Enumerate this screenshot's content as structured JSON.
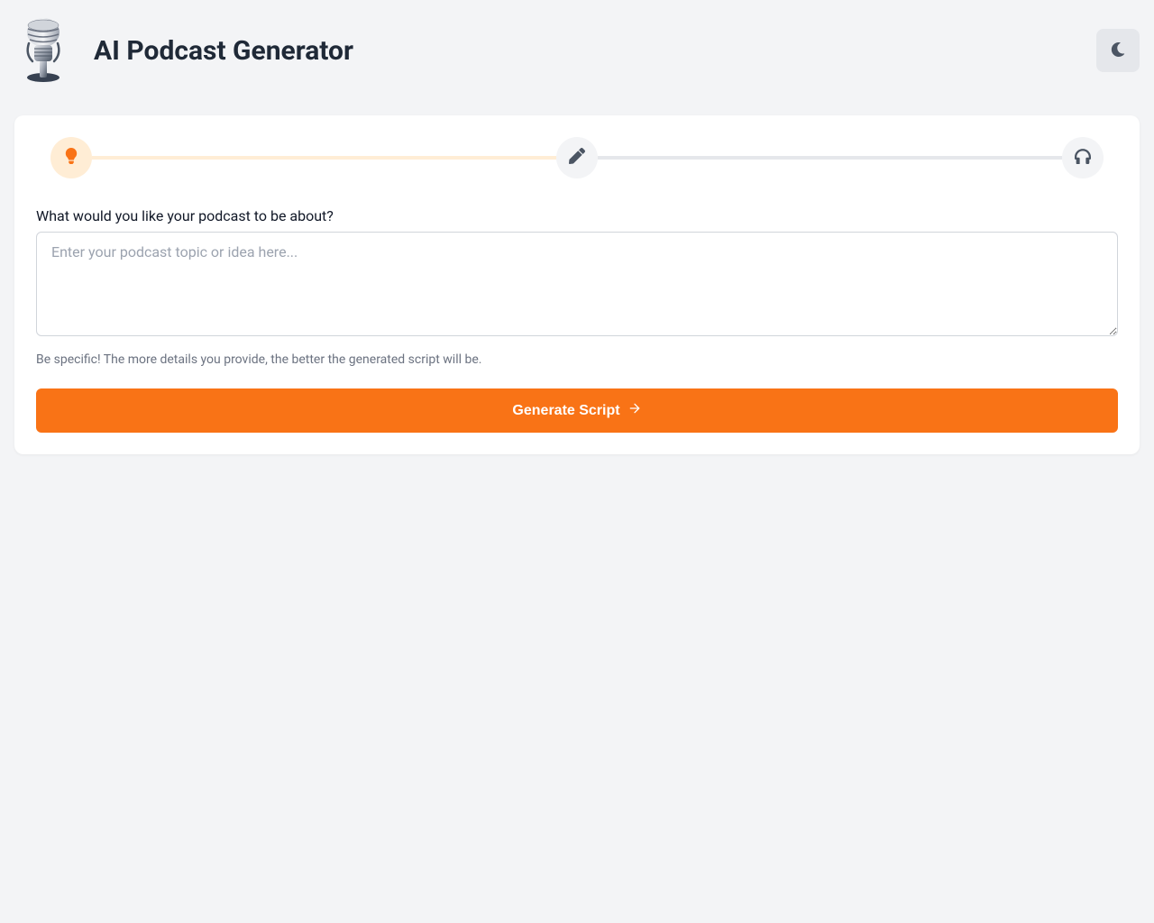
{
  "header": {
    "title": "AI Podcast Generator"
  },
  "stepper": {
    "steps": [
      {
        "id": "idea",
        "active": true,
        "icon": "lightbulb"
      },
      {
        "id": "edit",
        "active": false,
        "icon": "pencil"
      },
      {
        "id": "listen",
        "active": false,
        "icon": "headphones"
      }
    ]
  },
  "form": {
    "prompt_label": "What would you like your podcast to be about?",
    "topic_value": "",
    "topic_placeholder": "Enter your podcast topic or idea here...",
    "helper_text": "Be specific! The more details you provide, the better the generated script will be.",
    "generate_button_label": "Generate Script"
  },
  "theme": {
    "mode": "light",
    "accent_color": "#f97316",
    "accent_light": "#ffedd5"
  }
}
